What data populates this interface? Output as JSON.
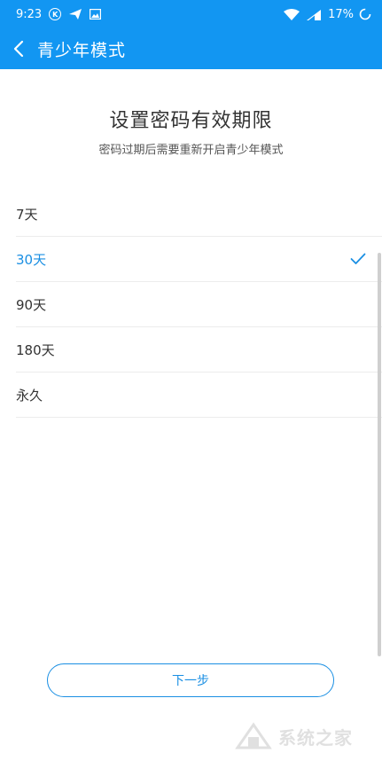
{
  "status_bar": {
    "time": "9:23",
    "battery": "17%",
    "icons": [
      "k-icon",
      "send-icon",
      "image-icon",
      "wifi-icon",
      "signal-icon",
      "battery-icon"
    ]
  },
  "header": {
    "title": "青少年模式",
    "back_icon": "chevron-left-icon"
  },
  "main": {
    "heading": "设置密码有效期限",
    "subheading": "密码过期后需要重新开启青少年模式",
    "options": [
      {
        "label": "7天",
        "selected": false
      },
      {
        "label": "30天",
        "selected": true
      },
      {
        "label": "90天",
        "selected": false
      },
      {
        "label": "180天",
        "selected": false
      },
      {
        "label": "永久",
        "selected": false
      }
    ],
    "next_button_label": "下一步"
  },
  "colors": {
    "accent": "#1296f2",
    "selected_text": "#1a8fe3"
  },
  "watermark": {
    "text": "系统之家"
  }
}
